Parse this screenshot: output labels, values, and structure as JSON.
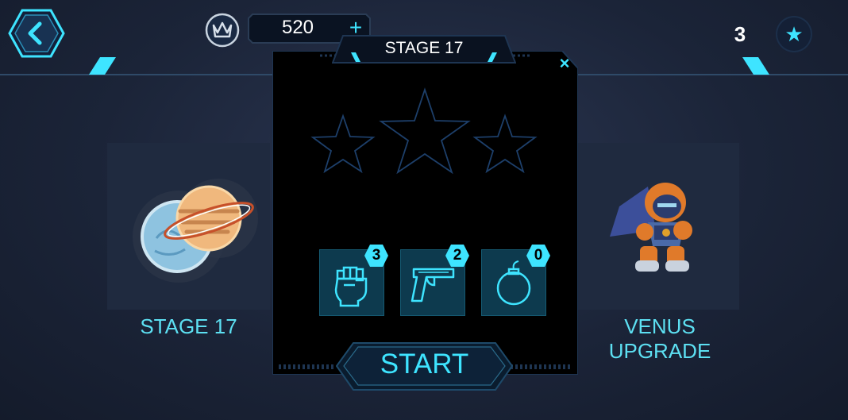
{
  "header": {
    "coins": "520",
    "plus": "+",
    "stars": "3",
    "star_glyph": "★"
  },
  "left_card": {
    "label": "STAGE 17"
  },
  "right_card": {
    "label": "VENUS UPGRADE"
  },
  "dialog": {
    "title": "STAGE 17",
    "close": "×",
    "stars_earned": 0,
    "stars_total": 3,
    "items": [
      {
        "name": "fist",
        "count": "3"
      },
      {
        "name": "pistol",
        "count": "2"
      },
      {
        "name": "bomb",
        "count": "0"
      }
    ],
    "start": "START"
  },
  "colors": {
    "accent": "#3ee4ff",
    "label": "#5de0f2",
    "panel": "#000000"
  }
}
